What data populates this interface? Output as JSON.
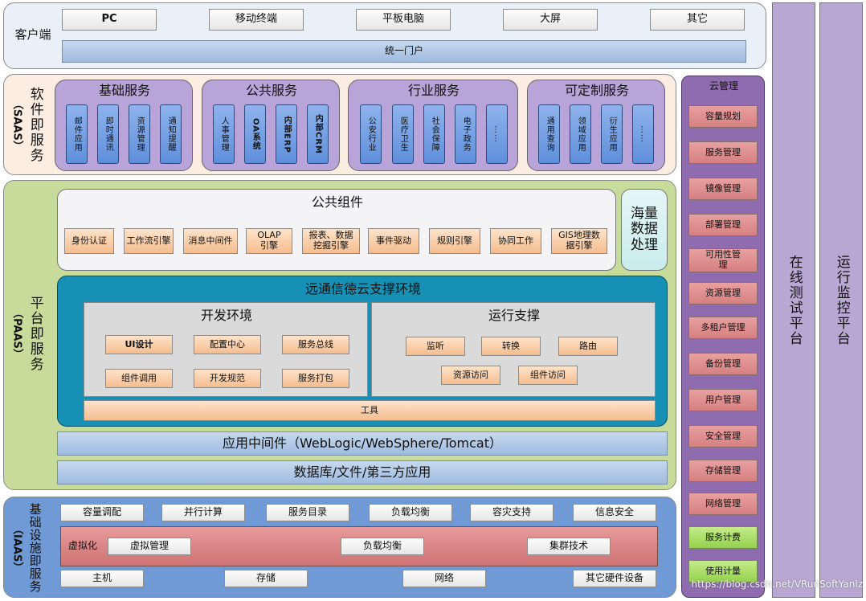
{
  "client": {
    "label": "客户端",
    "terminals": [
      "PC",
      "移动终端",
      "平板电脑",
      "大屏",
      "其它"
    ],
    "portal": "统一门户"
  },
  "saas": {
    "label": "软件即服务",
    "abbr": "（SAAS）",
    "groups": [
      {
        "title": "基础服务",
        "items": [
          "邮件应用",
          "即时通讯",
          "资源管理",
          "通知提醒"
        ]
      },
      {
        "title": "公共服务",
        "items": [
          "人事管理",
          "OA系统",
          "内部ERP",
          "内部CRM"
        ]
      },
      {
        "title": "行业服务",
        "items": [
          "公安行业",
          "医疗卫生",
          "社会保障",
          "电子政务",
          "……"
        ]
      },
      {
        "title": "可定制服务",
        "items": [
          "通用查询",
          "领域应用",
          "衍生应用",
          "……"
        ]
      }
    ]
  },
  "paas": {
    "label": "平台即服务",
    "abbr": "（PAAS）",
    "common_components": {
      "title": "公共组件",
      "items": [
        "身份认证",
        "工作流引擎",
        "消息中间件",
        "OLAP引擎",
        "报表、数据挖掘引擎",
        "事件驱动",
        "规则引擎",
        "协同工作",
        "GIS地理数据引擎"
      ]
    },
    "big_data": "海量数据处理",
    "cloud_env": {
      "title": "远通信德云支撑环境",
      "dev": {
        "title": "开发环境",
        "items": [
          "UI设计",
          "配置中心",
          "服务总线",
          "组件调用",
          "开发规范",
          "服务打包"
        ]
      },
      "run": {
        "title": "运行支撑",
        "items": [
          "监听",
          "转换",
          "路由",
          "资源访问",
          "组件访问"
        ]
      },
      "tools": "工具"
    },
    "middleware": "应用中间件（WebLogic/WebSphere/Tomcat）",
    "database": "数据库/文件/第三方应用"
  },
  "iaas": {
    "label": "基础设施即服务",
    "abbr": "（IAAS）",
    "top_row": [
      "容量调配",
      "并行计算",
      "服务目录",
      "负载均衡",
      "容灾支持",
      "信息安全"
    ],
    "virtualization": {
      "label": "虚拟化",
      "items": [
        "虚拟管理",
        "负载均衡",
        "集群技术"
      ]
    },
    "bottom_row": [
      "主机",
      "存储",
      "网络",
      "其它硬件设备"
    ]
  },
  "cloud_mgmt": {
    "title": "云管理",
    "items": [
      "容量规划",
      "服务管理",
      "镜像管理",
      "部署管理",
      "可用性管理",
      "资源管理",
      "多租户管理",
      "备份管理",
      "用户管理",
      "安全管理",
      "存储管理",
      "网络管理"
    ],
    "green_items": [
      "服务计费",
      "使用计量"
    ]
  },
  "online_test": "在线测试平台",
  "monitor": "运行监控平台",
  "watermark": "https://blog.csdn.net/VRunSoftYanlz",
  "colors": {
    "client_bg": "#eaf0f8",
    "saas_bg": "#fcede2",
    "paas_bg": "#c7dc9b",
    "iaas_bg": "#6f9ad6",
    "cloud_mgmt_bg": "#8f6bb0",
    "side_platform_bg": "#b9a7d3",
    "cloud_env_bg": "#1690b4"
  }
}
